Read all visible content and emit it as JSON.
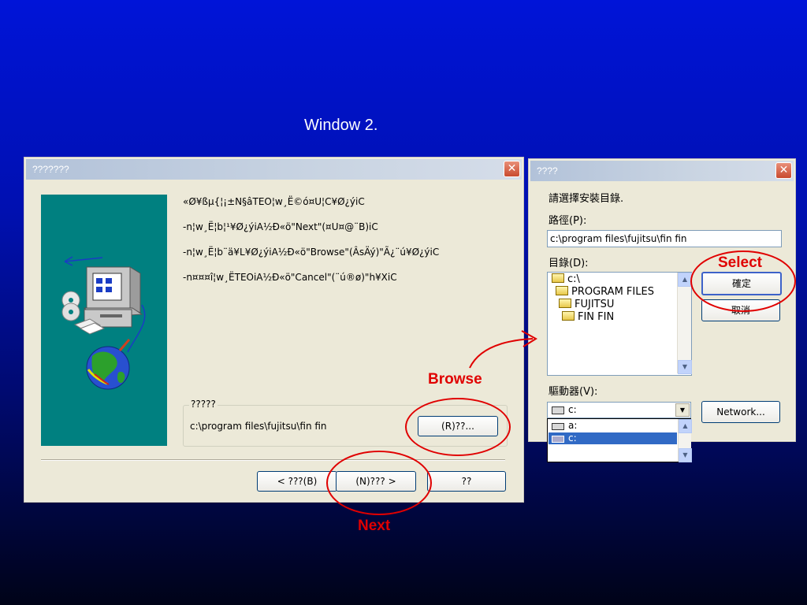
{
  "slide_title": "Window 2.",
  "setup_dialog": {
    "title": "???????",
    "messages": [
      "«Ø¥ßµ{¦¡±N§âTEO¦w¸Ë©ó¤U¦C¥Ø¿ýiC",
      "-n¦w¸Ë¦b¦¹¥Ø¿ýiA½Ð«ö\"Next\"(¤U¤@¨B)iC",
      "-n¦w¸Ë¦b¨ä¥L¥Ø¿ýiA½Ð«ö\"Browse\"(ÂsÄý)\"Ã¿¨ú¥Ø¿ýiC",
      "-n¤¤¤î¦w¸ËTEOiA½Ð«ö\"Cancel\"(¨ú®ø)\"h¥XiC"
    ],
    "group_label": "?????",
    "install_path": "c:\\program files\\fujitsu\\fin fin",
    "browse_label": "(R)??...",
    "back_label": "< ???(B)",
    "next_label": "(N)??? >",
    "cancel_label": "??"
  },
  "folder_dialog": {
    "title": "????",
    "prompt": "請選擇安裝目錄.",
    "path_label": "路徑(P):",
    "path_value": "c:\\program files\\fujitsu\\fin fin",
    "dir_label": "目錄(D):",
    "tree": [
      "c:\\",
      "PROGRAM FILES",
      "FUJITSU",
      "FIN FIN"
    ],
    "ok_label": "確定",
    "cancel_label": "取消",
    "drive_label": "驅動器(V):",
    "drive_value": "c:",
    "drive_options": [
      "a:",
      "c:"
    ],
    "network_label": "Network..."
  },
  "annotations": {
    "browse": "Browse",
    "next": "Next",
    "select": "Select"
  },
  "colors": {
    "annotation_red": "#e00000",
    "selection_blue": "#316ac5",
    "panel_teal": "#008080"
  }
}
